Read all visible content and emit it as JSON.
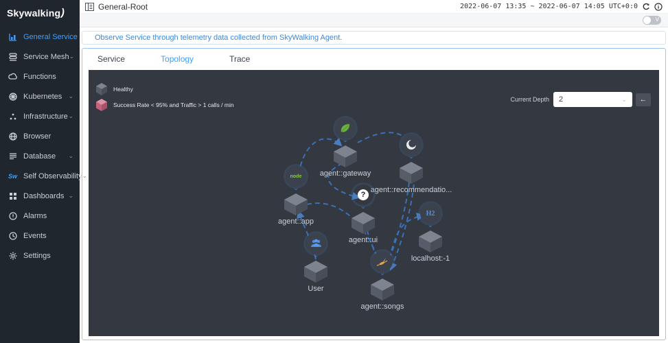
{
  "app": {
    "logo_text": "Skywalking"
  },
  "sidebar": {
    "items": [
      {
        "label": "General Service",
        "icon": "chart-icon",
        "active": true,
        "chevron": false
      },
      {
        "label": "Service Mesh",
        "icon": "mesh-icon",
        "active": false,
        "chevron": true
      },
      {
        "label": "Functions",
        "icon": "cloud-icon",
        "active": false,
        "chevron": false
      },
      {
        "label": "Kubernetes",
        "icon": "kubernetes-icon",
        "active": false,
        "chevron": true
      },
      {
        "label": "Infrastructure",
        "icon": "dots-icon",
        "active": false,
        "chevron": true
      },
      {
        "label": "Browser",
        "icon": "globe-icon",
        "active": false,
        "chevron": false
      },
      {
        "label": "Database",
        "icon": "database-icon",
        "active": false,
        "chevron": true
      },
      {
        "label": "Self Observability",
        "icon": "sw-icon",
        "active": false,
        "chevron": true
      },
      {
        "label": "Dashboards",
        "icon": "grid-icon",
        "active": false,
        "chevron": true
      },
      {
        "label": "Alarms",
        "icon": "alarm-icon",
        "active": false,
        "chevron": false
      },
      {
        "label": "Events",
        "icon": "clock-icon",
        "active": false,
        "chevron": false
      },
      {
        "label": "Settings",
        "icon": "gear-icon",
        "active": false,
        "chevron": false
      }
    ],
    "sw_mark": "Sw"
  },
  "topbar": {
    "title": "General-Root",
    "daterange": "2022-06-07 13:35 ~ 2022-06-07 14:05 UTC+0:0"
  },
  "strip": {
    "toggle_label": "V"
  },
  "notice": {
    "text": "Observe Service through telemetry data collected from SkyWalking Agent."
  },
  "tabs": [
    {
      "label": "Service",
      "active": false
    },
    {
      "label": "Topology",
      "active": true
    },
    {
      "label": "Trace",
      "active": false
    }
  ],
  "topology": {
    "legend": [
      {
        "label": "Healthy",
        "color": "#6d7480"
      },
      {
        "label": "Success Rate < 95% and Traffic > 1 calls / min",
        "color": "#c96f85"
      }
    ],
    "depth": {
      "label": "Current Depth",
      "value": "2"
    },
    "back_arrow": "←",
    "nodes": [
      {
        "label": "agent::gateway",
        "icon": "spring-leaf-icon"
      },
      {
        "label": "agent::recommendatio...",
        "icon": "moon-icon"
      },
      {
        "label": "agent::app",
        "icon": "nodejs-icon",
        "icon_text": "node"
      },
      {
        "label": "agent::ui",
        "icon": "question-icon",
        "icon_text": "?"
      },
      {
        "label": "localhost:-1",
        "icon": "h2-database-icon",
        "icon_text": "H2"
      },
      {
        "label": "User",
        "icon": "user-group-icon"
      },
      {
        "label": "agent::songs",
        "icon": "bird-icon"
      }
    ]
  },
  "colors": {
    "accent": "#409eff",
    "sidebar_bg": "#20262e",
    "topology_bg": "#333841",
    "edge": "#3d7cc9",
    "healthy_cube": "#6d7480",
    "alert_cube": "#c96f85"
  }
}
